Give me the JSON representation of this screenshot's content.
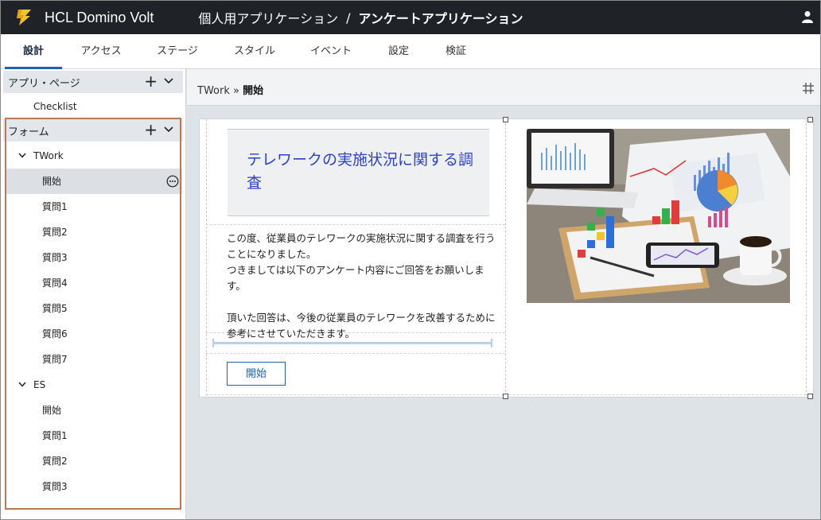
{
  "header": {
    "app_name": "HCL Domino Volt",
    "breadcrumb_app": "個人用アプリケーション",
    "breadcrumb_sep": "/",
    "breadcrumb_page": "アンケートアプリケーション"
  },
  "tabs": [
    {
      "label": "設計",
      "active": true
    },
    {
      "label": "アクセス"
    },
    {
      "label": "ステージ"
    },
    {
      "label": "スタイル"
    },
    {
      "label": "イベント"
    },
    {
      "label": "設定"
    },
    {
      "label": "検証"
    }
  ],
  "sidebar": {
    "app_pages_title": "アプリ・ページ",
    "app_pages": [
      "Checklist"
    ],
    "forms_title": "フォーム",
    "forms": [
      {
        "name": "TWork",
        "pages": [
          "開始",
          "質問1",
          "質問2",
          "質問3",
          "質問4",
          "質問5",
          "質問6",
          "質問7"
        ],
        "selected": "開始"
      },
      {
        "name": "ES",
        "pages": [
          "開始",
          "質問1",
          "質問2",
          "質問3"
        ]
      }
    ]
  },
  "main": {
    "breadcrumb_form": "TWork",
    "breadcrumb_sep": "»",
    "breadcrumb_page": "開始",
    "title": "テレワークの実施状況に関する調査",
    "body": "この度、従業員のテレワークの実施状況に関する調査を行うことになりました。\nつきましては以下のアンケート内容にご回答をお願いします。\n\n頂いた回答は、今後の従業員のテレワークを改善するために参考にさせていただきます。",
    "start_button": "開始"
  },
  "colors": {
    "topbar": "#1f2328",
    "accent": "#1f5fb5",
    "title_text": "#2b3fcf",
    "highlight_frame": "#b97a57"
  }
}
